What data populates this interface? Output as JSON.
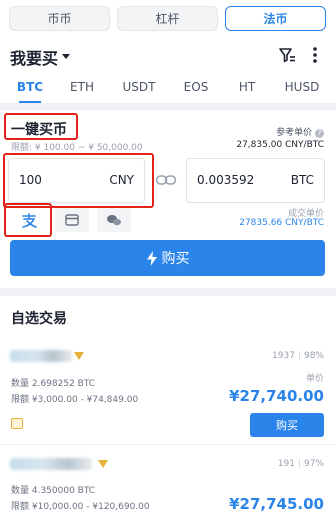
{
  "market_tabs": [
    {
      "label": "币币",
      "active": false
    },
    {
      "label": "杠杆",
      "active": false
    },
    {
      "label": "法币",
      "active": true
    }
  ],
  "header": {
    "title": "我要买",
    "icons": [
      "filter-icon",
      "more-icon"
    ]
  },
  "coin_tabs": [
    {
      "label": "BTC",
      "active": true
    },
    {
      "label": "ETH",
      "active": false
    },
    {
      "label": "USDT",
      "active": false
    },
    {
      "label": "EOS",
      "active": false
    },
    {
      "label": "HT",
      "active": false
    },
    {
      "label": "HUSD",
      "active": false
    }
  ],
  "quick_buy": {
    "title": "一键买币",
    "limit_text": "限额: ¥ 100.00 ~ ¥ 50,000.00",
    "ref_price_label": "参考单价",
    "ref_price_value": "27,835.00 CNY/BTC",
    "amount_value": "100",
    "amount_unit": "CNY",
    "crypto_value": "0.003592",
    "crypto_unit": "BTC",
    "deal_price_label": "成交单价",
    "deal_price_value": "27835.66 CNY/BTC",
    "buy_button": "购买",
    "payment_icons": [
      "alipay-icon",
      "bank-card-icon",
      "wechat-icon"
    ]
  },
  "list": {
    "title": "自选交易",
    "offers": [
      {
        "orders": "1937",
        "rate": "98%",
        "quantity": "数量 2.698252 BTC",
        "limit": "限额 ¥3,000.00 - ¥74,849.00",
        "unit_label": "单价",
        "price": "¥27,740.00",
        "buy_label": "购买"
      },
      {
        "orders": "191",
        "rate": "97%",
        "quantity": "数量 4.350000 BTC",
        "limit": "限额 ¥10,000.00 - ¥120,690.00",
        "price": "¥27,745.00"
      }
    ]
  },
  "colors": {
    "accent": "#2b84e9",
    "highlight": "#e2231a",
    "badge": "#e6b23c"
  }
}
